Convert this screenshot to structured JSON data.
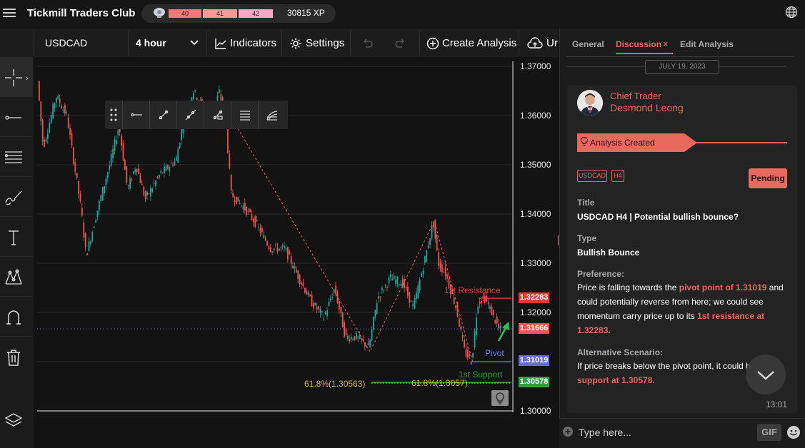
{
  "app": {
    "title": "Tickmill Traders Club"
  },
  "xp": {
    "segments": [
      "40",
      "41",
      "42"
    ],
    "total": "30815 XP"
  },
  "toolbar": {
    "symbol": "USDCAD",
    "interval": "4 hour",
    "indicators_label": "Indicators",
    "settings_label": "Settings",
    "create_analysis_label": "Create Analysis",
    "upload_label": "Ur"
  },
  "chart": {
    "price_labels": [
      "1.37000",
      "1.36000",
      "1.35000",
      "1.34000",
      "1.33000",
      "1.32000",
      "1.30000"
    ],
    "tags": {
      "resistance_price": "1.32283",
      "current_price": "1.31666",
      "pivot_price": "1.31019",
      "support_price": "1.30578"
    },
    "labels": {
      "resistance": "1st Resistance",
      "pivot": "Pivot",
      "support": "1st Support",
      "fib_left": "61.8%(1.30563)",
      "fib_right": "61.8%(1.3057)"
    },
    "colors": {
      "up": "#26a69a",
      "down": "#ef5350",
      "resistance": "#e53935",
      "pivot": "#6b6bd6",
      "support": "#2ea043",
      "fib": "#d4b84a"
    }
  },
  "panel": {
    "tabs": [
      "General",
      "Discussion",
      "Edit Analysis"
    ],
    "date": "JULY 19, 2023",
    "role": "Chief Trader",
    "author": "Desmond Leong",
    "banner": "Analysis Created",
    "tags": [
      "USDCAD",
      "H4"
    ],
    "status": "Pending",
    "title_label": "Title",
    "title_value": "USDCAD H4 | Potential bullish bounce?",
    "type_label": "Type",
    "type_value": "Bullish Bounce",
    "preference_label": "Preference:",
    "preference": {
      "p1": "Price is falling towards the ",
      "h1": "pivot point of 1.31019",
      "p2": " and could potentially reverse from here; we could see momentum carry price up to its ",
      "h2": "1st resistance at 1.32283",
      "p3": "."
    },
    "alt_label": "Alternative Scenario:",
    "alternative": {
      "p1": "If price breaks below the pivot point, it could h",
      "h1": "support at 1.30578."
    },
    "time": "13:01"
  },
  "composer": {
    "placeholder": "Type here...",
    "gif_label": "GIF"
  }
}
